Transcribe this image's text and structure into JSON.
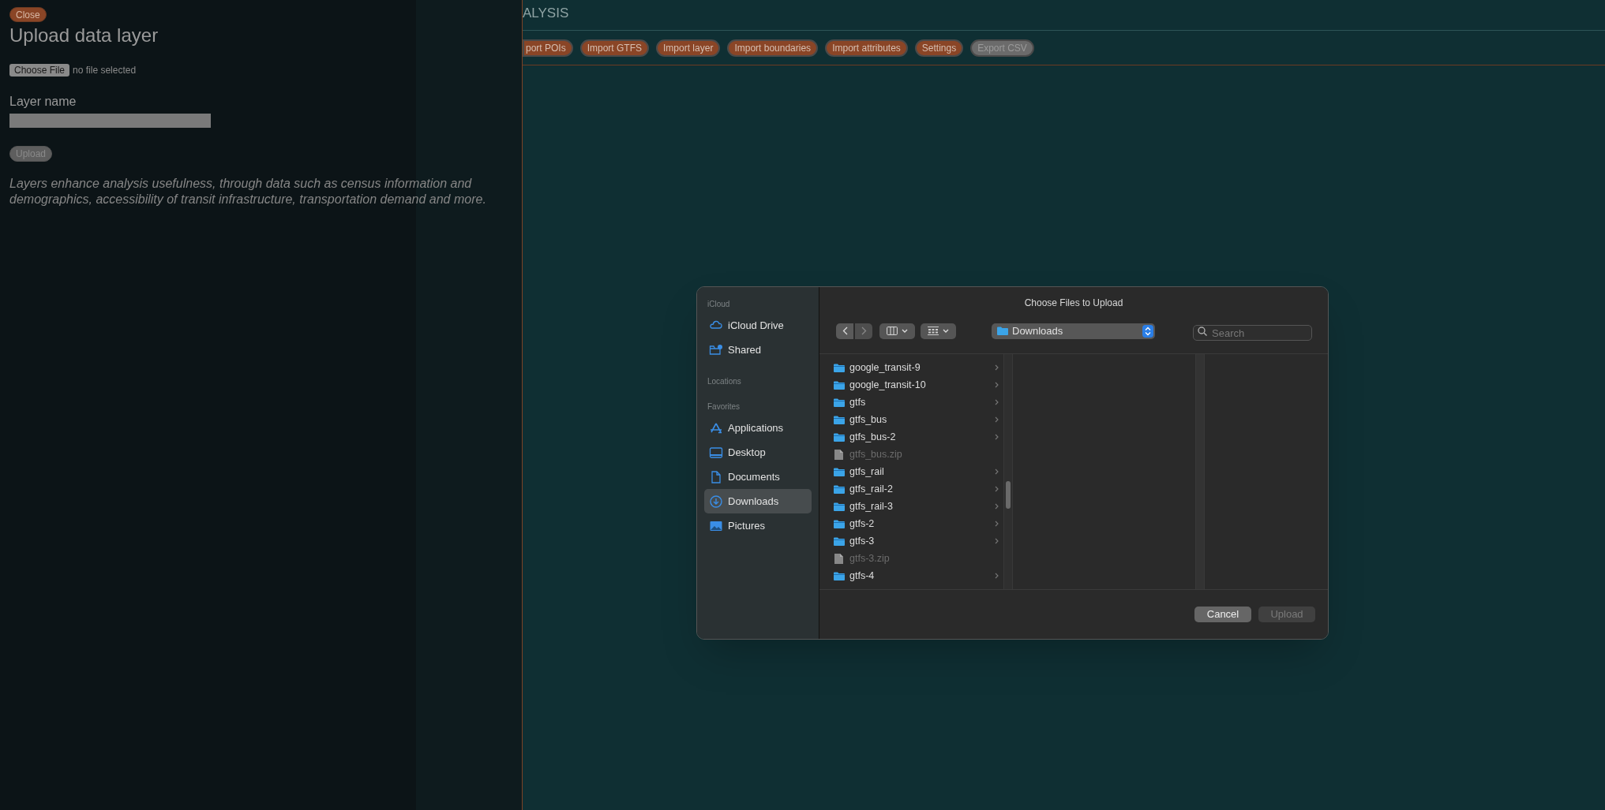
{
  "page": {
    "nav_partial": "ALYSIS",
    "toolbar": [
      {
        "label": "port POIs",
        "disabled": false,
        "cut": true
      },
      {
        "label": "Import GTFS",
        "disabled": false,
        "cut": false
      },
      {
        "label": "Import layer",
        "disabled": false,
        "cut": false
      },
      {
        "label": "Import boundaries",
        "disabled": false,
        "cut": false
      },
      {
        "label": "Import attributes",
        "disabled": false,
        "cut": false
      },
      {
        "label": "Settings",
        "disabled": false,
        "cut": false
      },
      {
        "label": "Export CSV",
        "disabled": true,
        "cut": false
      }
    ]
  },
  "panel": {
    "close": "Close",
    "title": "Upload data layer",
    "choose_file": "Choose File",
    "file_status": "no file selected",
    "layer_name_label": "Layer name",
    "upload": {
      "label": "Upload",
      "disabled": true
    },
    "description": "Layers enhance analysis usefulness, through data such as census information and demographics, accessibility of transit infrastructure, transportation demand and more."
  },
  "dialog": {
    "title": "Choose Files to Upload",
    "sidebar": [
      {
        "header": "iCloud",
        "items": [
          {
            "label": "iCloud Drive",
            "kind": "cloud",
            "selected": false
          },
          {
            "label": "Shared",
            "kind": "shared",
            "selected": false
          }
        ]
      },
      {
        "header": "Locations"
      },
      {
        "header": "Favorites",
        "items": [
          {
            "label": "Applications",
            "kind": "applications",
            "selected": false
          },
          {
            "label": "Desktop",
            "kind": "desktop",
            "selected": false
          },
          {
            "label": "Documents",
            "kind": "documents",
            "selected": false
          },
          {
            "label": "Downloads",
            "kind": "downloads",
            "selected": true
          },
          {
            "label": "Pictures",
            "kind": "pictures",
            "selected": false
          }
        ]
      }
    ],
    "location": "Downloads",
    "search_placeholder": "Search",
    "files": [
      {
        "name": "google_transit-9",
        "kind": "folder",
        "disabled": false
      },
      {
        "name": "google_transit-10",
        "kind": "folder",
        "disabled": false
      },
      {
        "name": "gtfs",
        "kind": "folder",
        "disabled": false
      },
      {
        "name": "gtfs_bus",
        "kind": "folder",
        "disabled": false
      },
      {
        "name": "gtfs_bus-2",
        "kind": "folder",
        "disabled": false
      },
      {
        "name": "gtfs_bus.zip",
        "kind": "file",
        "disabled": true
      },
      {
        "name": "gtfs_rail",
        "kind": "folder",
        "disabled": false
      },
      {
        "name": "gtfs_rail-2",
        "kind": "folder",
        "disabled": false
      },
      {
        "name": "gtfs_rail-3",
        "kind": "folder",
        "disabled": false
      },
      {
        "name": "gtfs-2",
        "kind": "folder",
        "disabled": false
      },
      {
        "name": "gtfs-3",
        "kind": "folder",
        "disabled": false
      },
      {
        "name": "gtfs-3.zip",
        "kind": "file",
        "disabled": true
      },
      {
        "name": "gtfs-4",
        "kind": "folder",
        "disabled": false
      }
    ],
    "buttons": [
      {
        "label": "Cancel",
        "disabled": false
      },
      {
        "label": "Upload",
        "disabled": true
      }
    ]
  }
}
